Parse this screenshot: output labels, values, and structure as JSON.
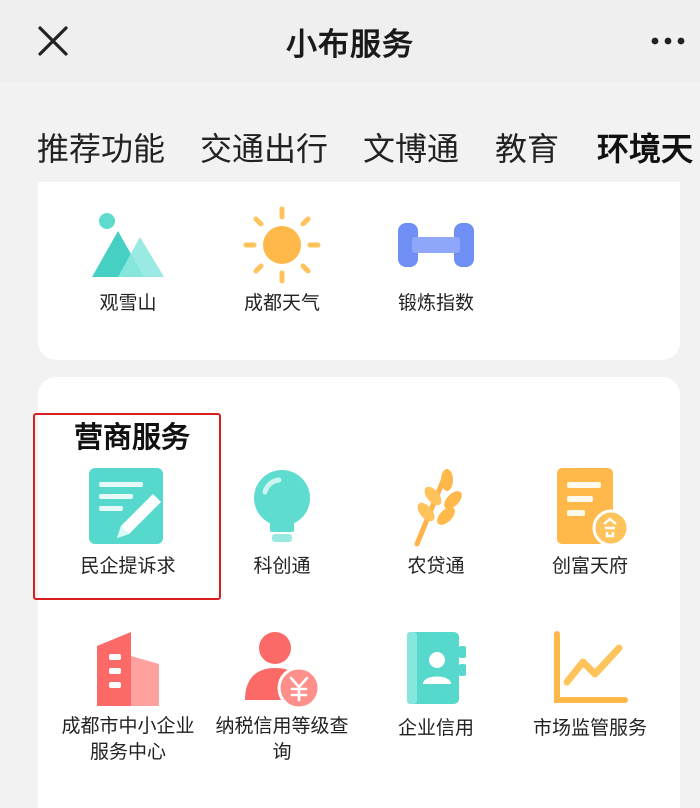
{
  "header": {
    "title": "小布服务"
  },
  "tabs": [
    {
      "label": "推荐功能"
    },
    {
      "label": "交通出行"
    },
    {
      "label": "文博通"
    },
    {
      "label": "教育"
    },
    {
      "label": "环境天"
    }
  ],
  "environment_card": {
    "items": [
      {
        "label": "观雪山",
        "icon": "mountain-icon"
      },
      {
        "label": "成都天气",
        "icon": "sun-icon"
      },
      {
        "label": "锻炼指数",
        "icon": "dumbbell-icon"
      }
    ]
  },
  "business_card": {
    "title": "营商服务",
    "items": [
      {
        "label": "民企提诉求",
        "icon": "note-edit-icon"
      },
      {
        "label": "科创通",
        "icon": "lightbulb-icon"
      },
      {
        "label": "农贷通",
        "icon": "wheat-icon"
      },
      {
        "label": "创富天府",
        "icon": "document-badge-icon"
      },
      {
        "label_line1": "成都市中小企业",
        "label_line2": "服务中心",
        "icon": "building-icon"
      },
      {
        "label_line1": "纳税信用等级查",
        "label_line2": "询",
        "icon": "user-yuan-icon"
      },
      {
        "label": "企业信用",
        "icon": "contact-book-icon"
      },
      {
        "label": "市场监管服务",
        "icon": "chart-trend-icon"
      }
    ]
  },
  "colors": {
    "highlight_border": "#d81e1e",
    "teal": "#4fd6c9",
    "orange": "#ffb84a",
    "blue": "#6f8ff5",
    "red": "#fb6a66"
  }
}
